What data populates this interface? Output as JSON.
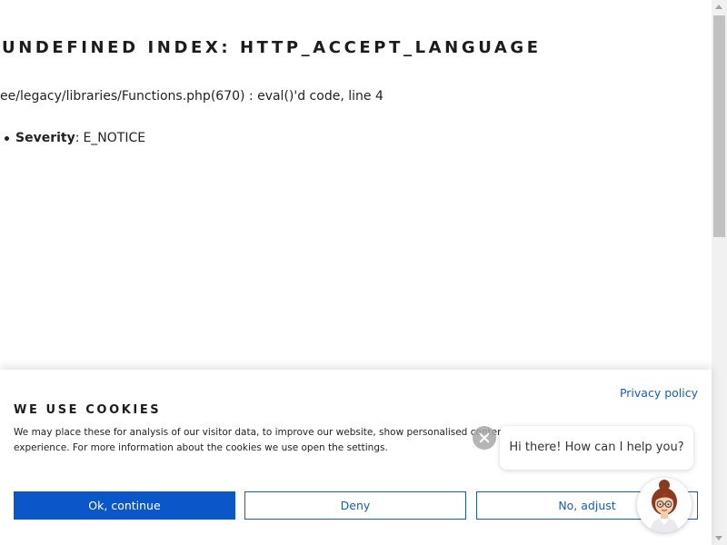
{
  "error": {
    "title": "UNDEFINED INDEX: HTTP_ACCEPT_LANGUAGE",
    "location": "ee/legacy/libraries/Functions.php(670) : eval()'d code, line 4",
    "details": [
      {
        "key": "Severity",
        "value": "E_NOTICE"
      }
    ]
  },
  "cookie_banner": {
    "title": "WE USE COOKIES",
    "privacy_link": "Privacy policy",
    "text": "We may place these for analysis of our visitor data, to improve our website, show personalised content and to give you a great website experience. For more information about the cookies we use open the settings.",
    "buttons": {
      "ok": "Ok, continue",
      "deny": "Deny",
      "adjust": "No, adjust"
    }
  },
  "chat": {
    "greeting": "Hi there! How can I help you?"
  },
  "colors": {
    "accent": "#0b57c9",
    "link": "#1b5cb5"
  }
}
